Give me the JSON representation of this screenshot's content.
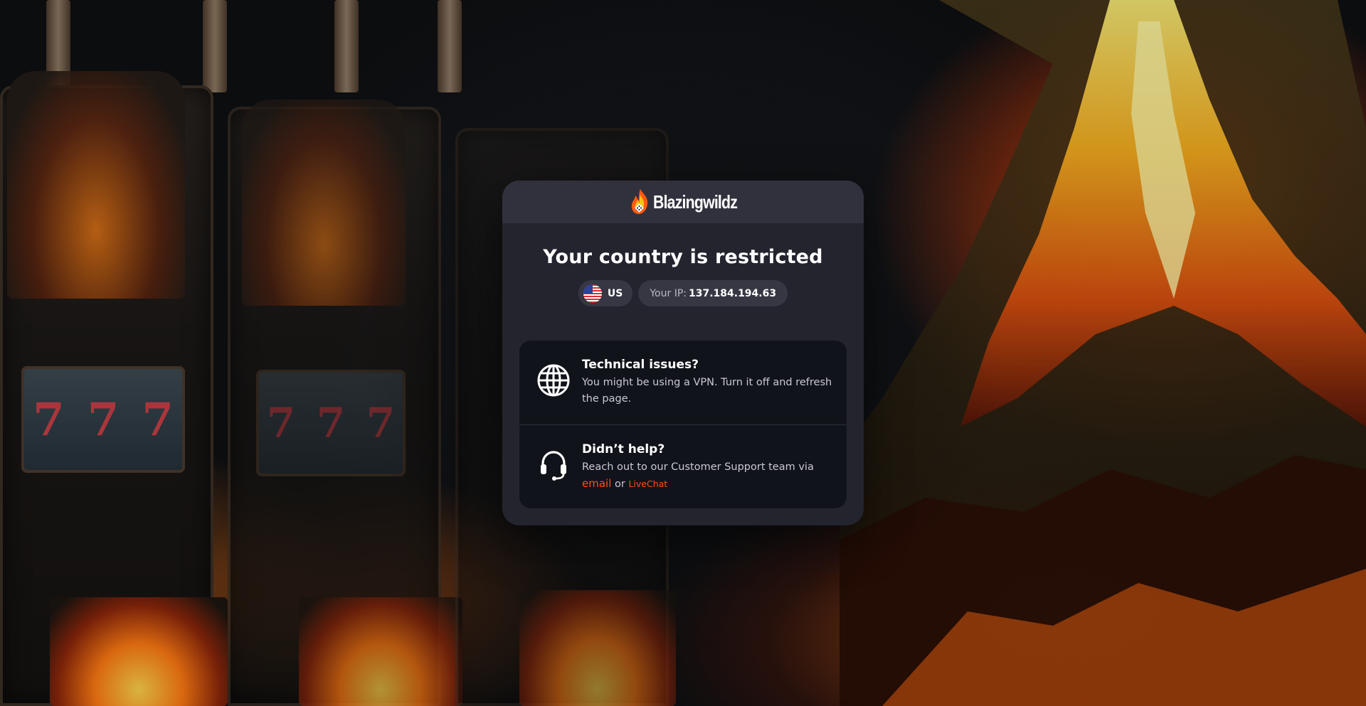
{
  "brand": {
    "name": "Blazingwildz"
  },
  "restriction": {
    "title": "Your country is restricted",
    "country_code": "US",
    "ip_label": "Your IP:",
    "ip_value": "137.184.194.63"
  },
  "help": [
    {
      "title": "Technical issues?",
      "description": "You might be using a VPN. Turn it off and refresh the page.",
      "icon": "globe-icon"
    },
    {
      "title": "Didn’t help?",
      "description": "Reach out to our Customer Support team via",
      "email_label": "email",
      "or_text": "or",
      "livechat_label": "LiveChat",
      "icon": "headset-icon"
    }
  ],
  "colors": {
    "accent": "#ff4d17",
    "modal_bg": "#24242f",
    "header_bg": "#31313e",
    "box_bg": "#11131a",
    "chip_bg": "#373744"
  }
}
